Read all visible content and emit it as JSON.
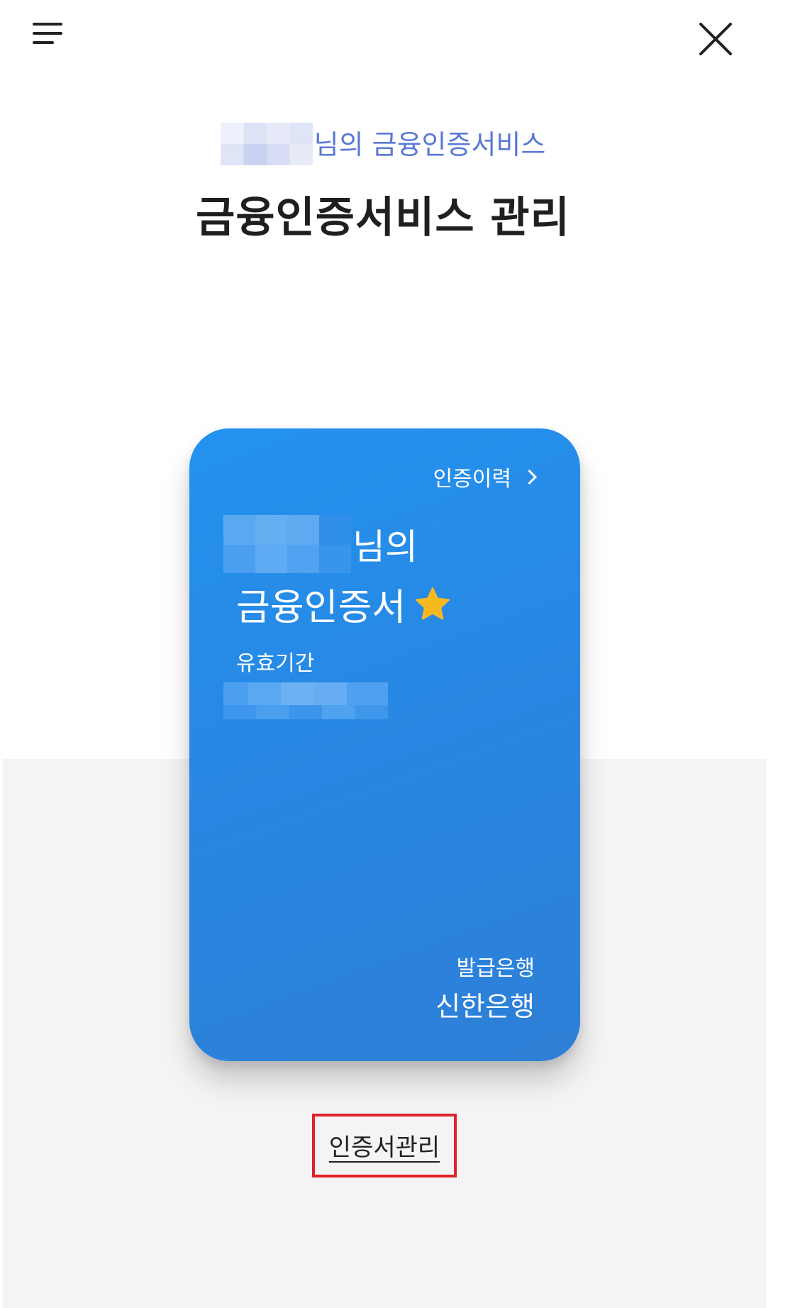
{
  "header": {
    "menu_icon": "hamburger-menu-icon",
    "close_icon": "close-icon"
  },
  "subtitle": {
    "suffix": "님의 금융인증서비스"
  },
  "title": "금융인증서비스 관리",
  "card": {
    "history_link": "인증이력",
    "name_suffix": "님의",
    "certificate_title": "금융인증서",
    "star_icon": "star-icon",
    "validity_label": "유효기간",
    "issuer_label": "발급은행",
    "issuer_name": "신한은행",
    "colors": {
      "card_top": "#2392ee",
      "card_bottom": "#2e7fd6",
      "star": "#f6b920"
    }
  },
  "manage_link": "인증서관리",
  "colors": {
    "subtitle": "#5b78d6",
    "highlight_box": "#e0212b",
    "panel_bg": "#f4f4f4"
  }
}
